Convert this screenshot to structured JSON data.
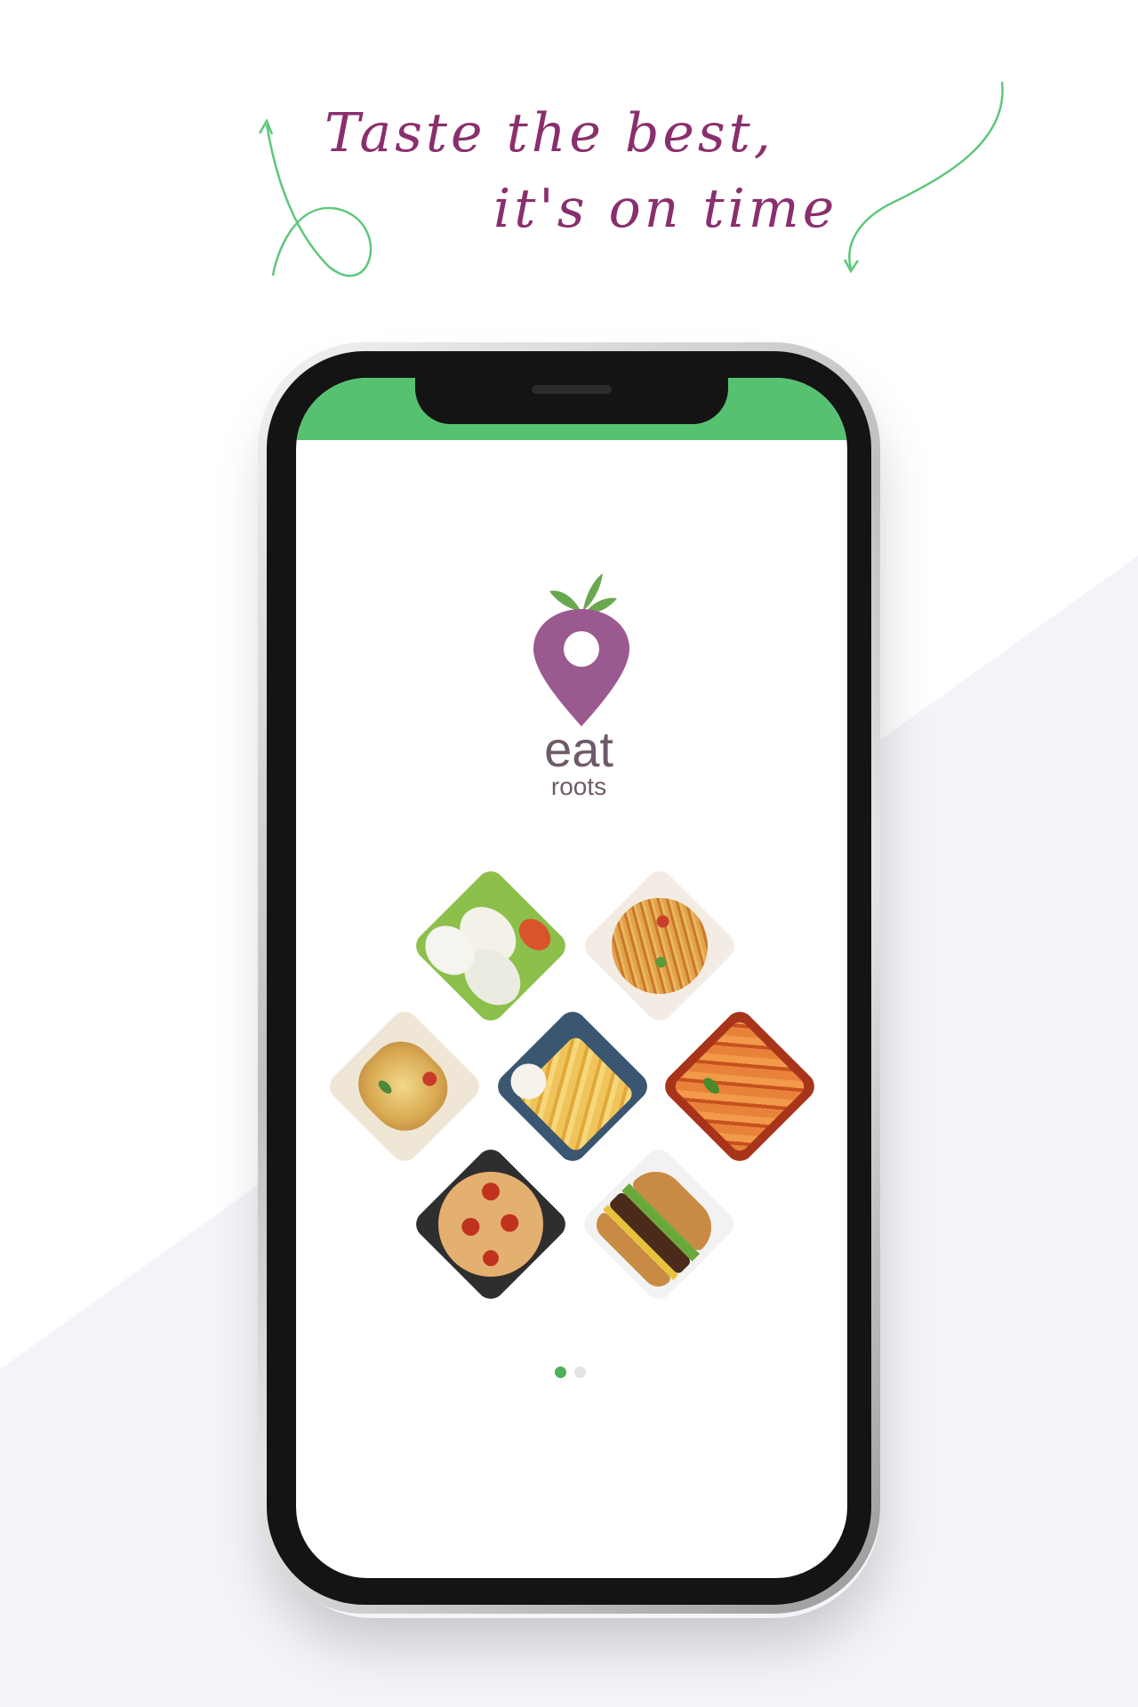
{
  "tagline": {
    "line1": "Taste the best,",
    "line2": "it's on time"
  },
  "app": {
    "brand_word": "eat",
    "brand_sub": "roots"
  },
  "food_tiles": [
    {
      "name": "idli",
      "base": "#e9e6d9",
      "accent": "#7aa83a"
    },
    {
      "name": "noodles",
      "base": "#d89a4a",
      "accent": "#c8402a"
    },
    {
      "name": "chaat",
      "base": "#e3c68a",
      "accent": "#b07a3a"
    },
    {
      "name": "fries",
      "base": "#e8b84a",
      "accent": "#3a5670"
    },
    {
      "name": "pasta",
      "base": "#d96a2a",
      "accent": "#8a2a1a"
    },
    {
      "name": "pizza",
      "base": "#d9a066",
      "accent": "#b8321e"
    },
    {
      "name": "burger",
      "base": "#b5773a",
      "accent": "#4a2a18"
    }
  ],
  "pager": {
    "active_index": 0,
    "count": 2
  },
  "colors": {
    "tagline": "#8a2f6e",
    "status_bar": "#56c271",
    "logo_pin": "#9b5a8f",
    "logo_leaf": "#6aa84f",
    "dot_active": "#4caf5a",
    "dot_inactive": "#e4e4e4"
  }
}
